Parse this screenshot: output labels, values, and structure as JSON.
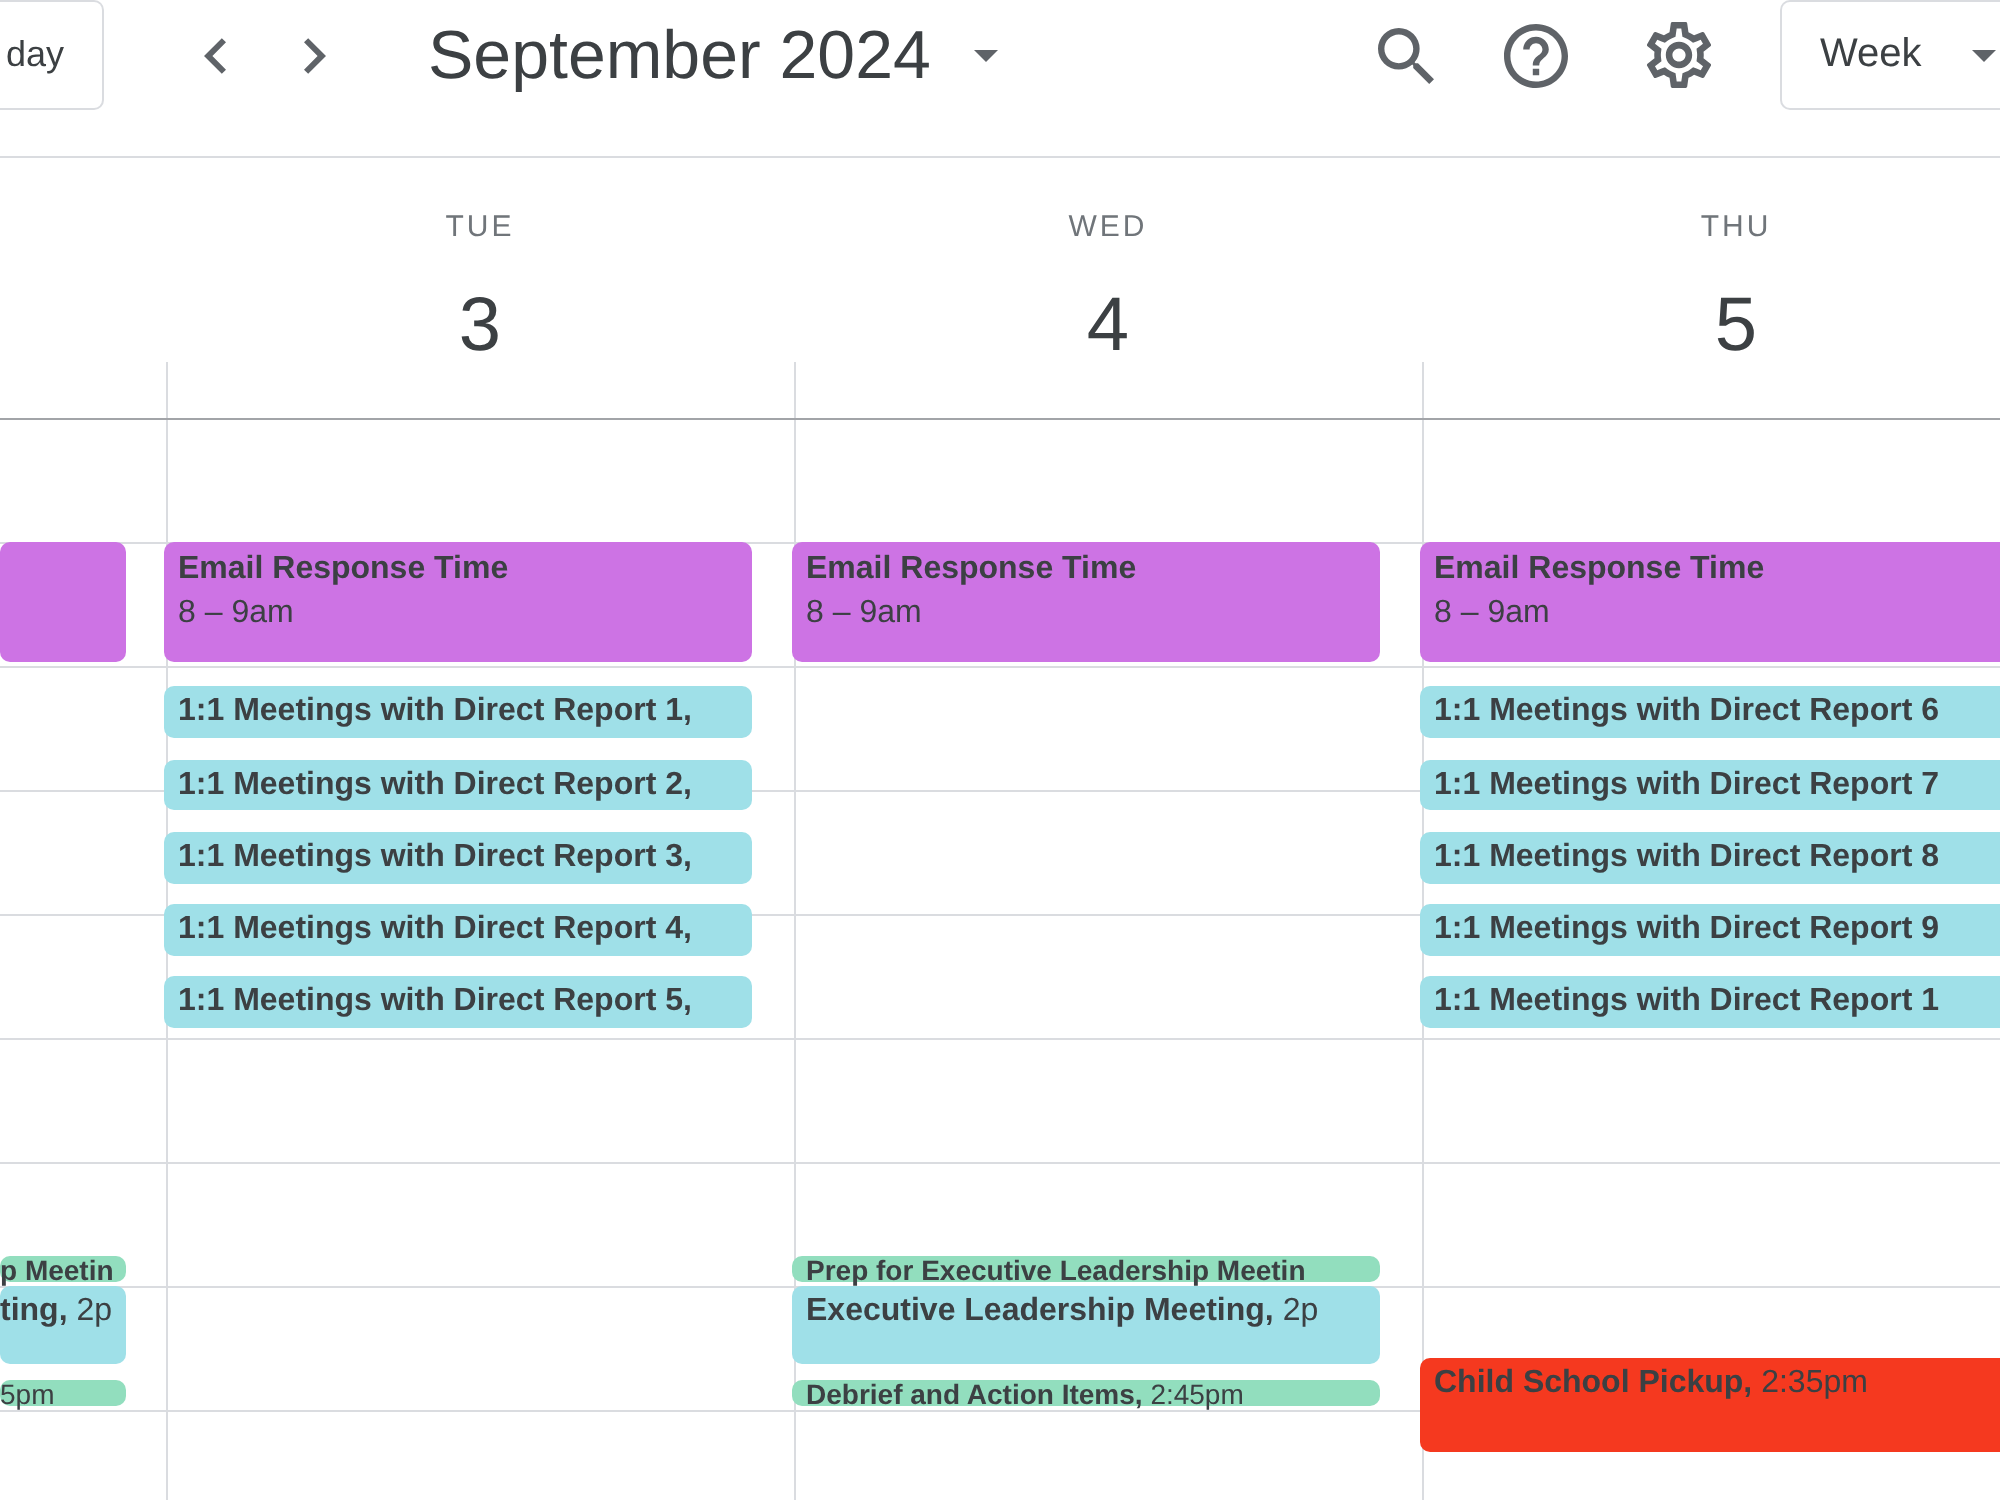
{
  "toolbar": {
    "today_button": "day",
    "title": "September 2024",
    "view_button": "Week"
  },
  "days": [
    {
      "events": [
        {
          "kind": "stacked",
          "color": "#cd73e4"
        },
        {
          "kind": "inline",
          "title": "p Meetin",
          "color": "#92debe"
        },
        {
          "kind": "inline",
          "title": "ting,",
          "time": "2p",
          "color": "#9fe0e8"
        },
        {
          "kind": "inline",
          "time": "5pm",
          "color": "#92debe"
        }
      ]
    },
    {
      "weekday": "TUE",
      "date": "3",
      "events": [
        {
          "kind": "stacked",
          "title": "Email Response Time",
          "time": "8 – 9am",
          "color": "#cd73e4"
        },
        {
          "kind": "inline",
          "title": "1:1 Meetings with Direct Report 1,",
          "color": "#9fe0e8"
        },
        {
          "kind": "inline",
          "title": "1:1 Meetings with Direct Report 2,",
          "color": "#9fe0e8"
        },
        {
          "kind": "inline",
          "title": "1:1 Meetings with Direct Report 3,",
          "color": "#9fe0e8"
        },
        {
          "kind": "inline",
          "title": "1:1 Meetings with Direct Report 4,",
          "color": "#9fe0e8"
        },
        {
          "kind": "inline",
          "title": "1:1 Meetings with Direct Report 5,",
          "color": "#9fe0e8"
        }
      ]
    },
    {
      "weekday": "WED",
      "date": "4",
      "events": [
        {
          "kind": "stacked",
          "title": "Email Response Time",
          "time": "8 – 9am",
          "color": "#cd73e4"
        },
        {
          "kind": "inline",
          "title": "Prep for Executive Leadership Meetin",
          "color": "#92debe"
        },
        {
          "kind": "inline",
          "title": "Executive Leadership Meeting,",
          "time": "2p",
          "color": "#9fe0e8"
        },
        {
          "kind": "inline",
          "title": "Debrief and Action Items,",
          "time": "2:45pm",
          "color": "#92debe"
        }
      ]
    },
    {
      "weekday": "THU",
      "date": "5",
      "events": [
        {
          "kind": "stacked",
          "title": "Email Response Time",
          "time": "8 – 9am",
          "color": "#cd73e4"
        },
        {
          "kind": "inline",
          "title": "1:1 Meetings with Direct Report 6",
          "color": "#9fe0e8"
        },
        {
          "kind": "inline",
          "title": "1:1 Meetings with Direct Report 7",
          "color": "#9fe0e8"
        },
        {
          "kind": "inline",
          "title": "1:1 Meetings with Direct Report 8",
          "color": "#9fe0e8"
        },
        {
          "kind": "inline",
          "title": "1:1 Meetings with Direct Report 9",
          "color": "#9fe0e8"
        },
        {
          "kind": "inline",
          "title": "1:1 Meetings with Direct Report 1",
          "color": "#9fe0e8"
        },
        {
          "kind": "inline",
          "title": "Child School Pickup,",
          "time": "2:35pm",
          "color": "#f5391f"
        }
      ]
    }
  ]
}
